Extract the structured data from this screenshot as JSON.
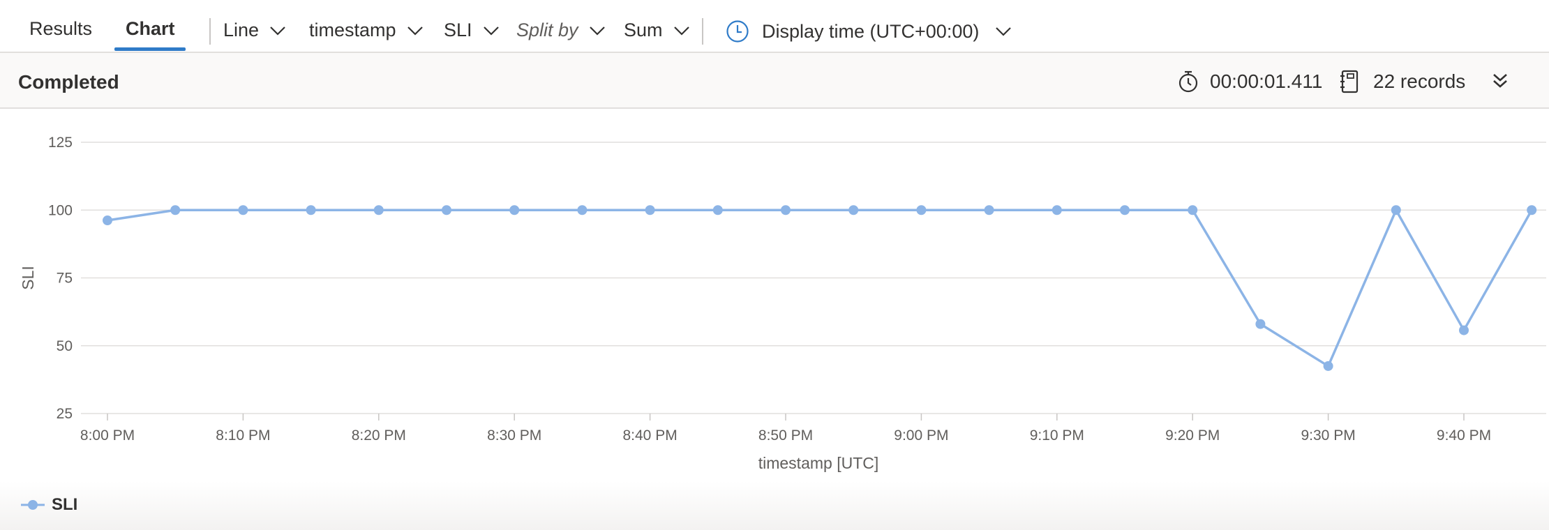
{
  "tabs": [
    {
      "label": "Results",
      "active": false
    },
    {
      "label": "Chart",
      "active": true
    }
  ],
  "toolbar": {
    "chart_type": "Line",
    "x_column": "timestamp",
    "y_column": "SLI",
    "split_by_placeholder": "Split by",
    "aggregation": "Sum",
    "display_time": "Display time (UTC+00:00)"
  },
  "status": {
    "title": "Completed",
    "duration": "00:00:01.411",
    "records": "22 records"
  },
  "colors": {
    "accent": "#2f7bc8",
    "series": "#8cb4e6",
    "grid": "#e1dfdd"
  },
  "icons": [
    "chevron-down-icon",
    "clock-icon",
    "stopwatch-icon",
    "records-icon",
    "double-chevron-down-icon"
  ],
  "chart_data": {
    "type": "line",
    "xlabel": "timestamp [UTC]",
    "ylabel": "SLI",
    "ylim": [
      25,
      125
    ],
    "yticks": [
      25,
      50,
      75,
      100,
      125
    ],
    "xticks": [
      "8:00 PM",
      "8:10 PM",
      "8:20 PM",
      "8:30 PM",
      "8:40 PM",
      "8:50 PM",
      "9:00 PM",
      "9:10 PM",
      "9:20 PM",
      "9:30 PM",
      "9:40 PM"
    ],
    "x": [
      "8:00 PM",
      "8:05 PM",
      "8:10 PM",
      "8:15 PM",
      "8:20 PM",
      "8:25 PM",
      "8:30 PM",
      "8:35 PM",
      "8:40 PM",
      "8:45 PM",
      "8:50 PM",
      "8:55 PM",
      "9:00 PM",
      "9:05 PM",
      "9:10 PM",
      "9:15 PM",
      "9:20 PM",
      "9:25 PM",
      "9:30 PM",
      "9:35 PM",
      "9:40 PM",
      "9:45 PM"
    ],
    "series": [
      {
        "name": "SLI",
        "values": [
          96.2,
          100,
          100,
          100,
          100,
          100,
          100,
          100,
          100,
          100,
          100,
          100,
          100,
          100,
          100,
          100,
          100,
          58,
          42.5,
          100,
          55.7,
          100
        ]
      }
    ],
    "grid": true,
    "legend": "bottom-left"
  }
}
